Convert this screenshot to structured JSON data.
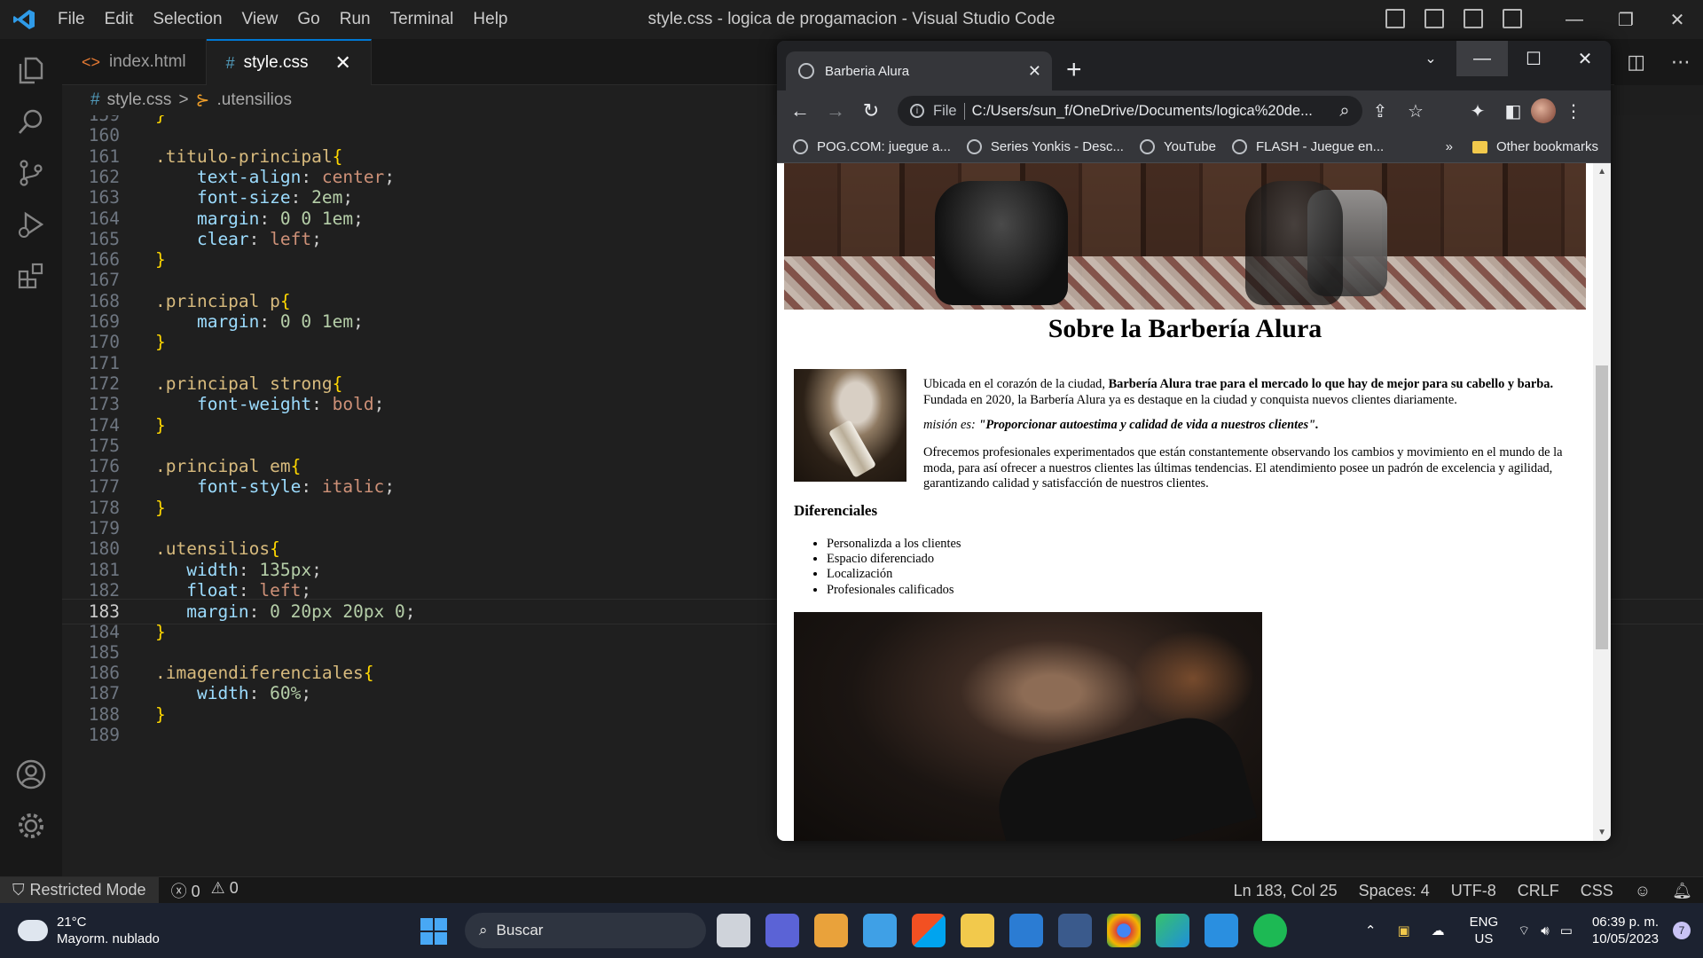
{
  "window": {
    "title": "style.css - logica de progamacion - Visual Studio Code",
    "menu": [
      "File",
      "Edit",
      "Selection",
      "View",
      "Go",
      "Run",
      "Terminal",
      "Help"
    ],
    "controls": {
      "minimize": "—",
      "maximize": "❐",
      "close": "✕"
    }
  },
  "activitybar": [
    "explorer-icon",
    "search-icon",
    "source-control-icon",
    "run-debug-icon",
    "extensions-icon",
    "account-icon",
    "settings-gear-icon"
  ],
  "tabs": [
    {
      "icon": "<>",
      "label": "index.html",
      "active": false
    },
    {
      "icon": "#",
      "label": "style.css",
      "active": true,
      "close": "✕"
    }
  ],
  "breadcrumb": {
    "file": "style.css",
    "separator": ">",
    "symbol": ".utensilios"
  },
  "editor": {
    "current_line": 183,
    "lines": [
      {
        "n": "159",
        "tokens": [
          [
            "}",
            "brace"
          ]
        ]
      },
      {
        "n": "160",
        "tokens": []
      },
      {
        "n": "161",
        "tokens": [
          [
            ".titulo-principal",
            "sel"
          ],
          [
            "{",
            "brace"
          ]
        ]
      },
      {
        "n": "162",
        "tokens": [
          [
            "    text-align",
            "prop"
          ],
          [
            ": ",
            "punc"
          ],
          [
            "center",
            "val"
          ],
          [
            ";",
            "punc"
          ]
        ]
      },
      {
        "n": "163",
        "tokens": [
          [
            "    font-size",
            "prop"
          ],
          [
            ": ",
            "punc"
          ],
          [
            "2em",
            "num"
          ],
          [
            ";",
            "punc"
          ]
        ]
      },
      {
        "n": "164",
        "tokens": [
          [
            "    margin",
            "prop"
          ],
          [
            ": ",
            "punc"
          ],
          [
            "0 0 1em",
            "num"
          ],
          [
            ";",
            "punc"
          ]
        ]
      },
      {
        "n": "165",
        "tokens": [
          [
            "    clear",
            "prop"
          ],
          [
            ": ",
            "punc"
          ],
          [
            "left",
            "val"
          ],
          [
            ";",
            "punc"
          ]
        ]
      },
      {
        "n": "166",
        "tokens": [
          [
            "}",
            "brace"
          ]
        ]
      },
      {
        "n": "167",
        "tokens": []
      },
      {
        "n": "168",
        "tokens": [
          [
            ".principal p",
            "sel"
          ],
          [
            "{",
            "brace"
          ]
        ]
      },
      {
        "n": "169",
        "tokens": [
          [
            "    margin",
            "prop"
          ],
          [
            ": ",
            "punc"
          ],
          [
            "0 0 1em",
            "num"
          ],
          [
            ";",
            "punc"
          ]
        ]
      },
      {
        "n": "170",
        "tokens": [
          [
            "}",
            "brace"
          ]
        ]
      },
      {
        "n": "171",
        "tokens": []
      },
      {
        "n": "172",
        "tokens": [
          [
            ".principal strong",
            "sel"
          ],
          [
            "{",
            "brace"
          ]
        ]
      },
      {
        "n": "173",
        "tokens": [
          [
            "    font-weight",
            "prop"
          ],
          [
            ": ",
            "punc"
          ],
          [
            "bold",
            "val"
          ],
          [
            ";",
            "punc"
          ]
        ]
      },
      {
        "n": "174",
        "tokens": [
          [
            "}",
            "brace"
          ]
        ]
      },
      {
        "n": "175",
        "tokens": []
      },
      {
        "n": "176",
        "tokens": [
          [
            ".principal em",
            "sel"
          ],
          [
            "{",
            "brace"
          ]
        ]
      },
      {
        "n": "177",
        "tokens": [
          [
            "    font-style",
            "prop"
          ],
          [
            ": ",
            "punc"
          ],
          [
            "italic",
            "val"
          ],
          [
            ";",
            "punc"
          ]
        ]
      },
      {
        "n": "178",
        "tokens": [
          [
            "}",
            "brace"
          ]
        ]
      },
      {
        "n": "179",
        "tokens": []
      },
      {
        "n": "180",
        "tokens": [
          [
            ".utensilios",
            "sel"
          ],
          [
            "{",
            "brace"
          ]
        ]
      },
      {
        "n": "181",
        "tokens": [
          [
            "   width",
            "prop"
          ],
          [
            ": ",
            "punc"
          ],
          [
            "135px",
            "num"
          ],
          [
            ";",
            "punc"
          ]
        ]
      },
      {
        "n": "182",
        "tokens": [
          [
            "   float",
            "prop"
          ],
          [
            ": ",
            "punc"
          ],
          [
            "left",
            "val"
          ],
          [
            ";",
            "punc"
          ]
        ]
      },
      {
        "n": "183",
        "tokens": [
          [
            "   margin",
            "prop"
          ],
          [
            ": ",
            "punc"
          ],
          [
            "0 20px 20px 0",
            "num"
          ],
          [
            ";",
            "punc"
          ]
        ]
      },
      {
        "n": "184",
        "tokens": [
          [
            "}",
            "brace"
          ]
        ]
      },
      {
        "n": "185",
        "tokens": []
      },
      {
        "n": "186",
        "tokens": [
          [
            ".imagendiferenciales",
            "sel"
          ],
          [
            "{",
            "brace"
          ]
        ]
      },
      {
        "n": "187",
        "tokens": [
          [
            "    width",
            "prop"
          ],
          [
            ": ",
            "punc"
          ],
          [
            "60%",
            "num"
          ],
          [
            ";",
            "punc"
          ]
        ]
      },
      {
        "n": "188",
        "tokens": [
          [
            "}",
            "brace"
          ]
        ]
      },
      {
        "n": "189",
        "tokens": []
      }
    ]
  },
  "statusbar": {
    "restricted": "Restricted Mode",
    "errors": "0",
    "warnings": "0",
    "position": "Ln 183, Col 25",
    "spaces": "Spaces: 4",
    "encoding": "UTF-8",
    "eol": "CRLF",
    "language": "CSS"
  },
  "chrome": {
    "tab_title": "Barberia Alura",
    "tab_close": "✕",
    "new_tab": "+",
    "scheme": "File",
    "url": "C:/Users/sun_f/OneDrive/Documents/logica%20de...",
    "bookmarks": [
      "POG.COM: juegue a...",
      "Series Yonkis - Desc...",
      "YouTube",
      "FLASH - Juegue en..."
    ],
    "bookmarks_more": "»",
    "other_bookmarks": "Other bookmarks"
  },
  "webpage": {
    "title": "Sobre la Barbería Alura",
    "p1_plain": "Ubicada en el corazón de la ciudad, ",
    "p1_bold": "Barbería Alura trae para el mercado lo que hay de mejor para su cabello y barba.",
    "p1_rest": " Fundada en 2020, la Barbería Alura ya es destaque en la ciudad y conquista nuevos clientes diariamente.",
    "mision_label": "misión es: ",
    "mision_text": "\"Proporcionar autoestima y calidad de vida a nuestros clientes\".",
    "p3": "Ofrecemos profesionales experimentados que están constantemente observando los cambios y movimiento en el mundo de la moda, para así ofrecer a nuestros clientes las últimas tendencias. El atendimiento posee un padrón de excelencia y agilidad, garantizando calidad y satisfacción de nuestros clientes.",
    "dif_heading": "Diferenciales",
    "dif_items": [
      "Personalizda a los clientes",
      "Espacio diferenciado",
      "Localización",
      "Profesionales calificados"
    ]
  },
  "taskbar": {
    "weather_temp": "21°C",
    "weather_desc": "Mayorm. nublado",
    "search": "Buscar",
    "lang1": "ENG",
    "lang2": "US",
    "time": "06:39 p. m.",
    "date": "10/05/2023",
    "notifications": "7"
  }
}
